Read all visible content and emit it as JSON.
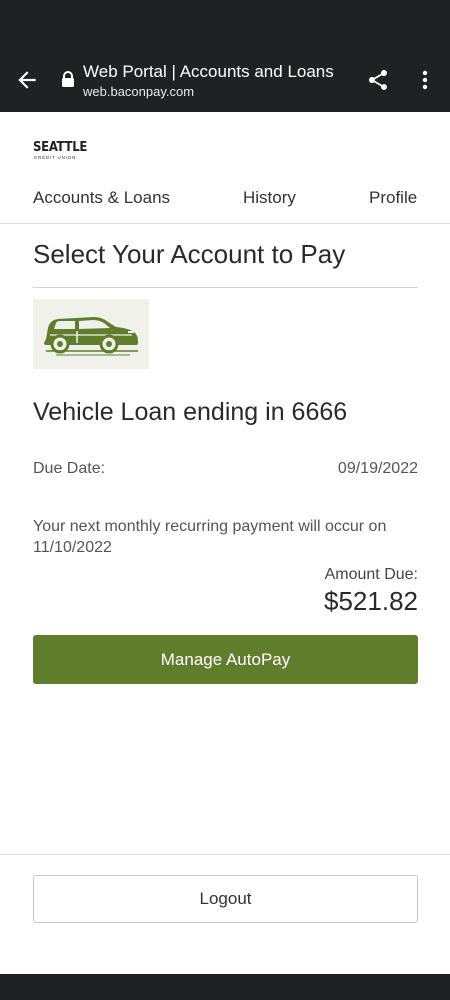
{
  "browser": {
    "page_title": "Web Portal | Accounts and Loans",
    "domain": "web.baconpay.com"
  },
  "site": {
    "logo_main": "SEATTLE",
    "logo_sub": "CREDIT UNION",
    "nav": {
      "accounts": "Accounts & Loans",
      "history": "History",
      "profile": "Profile"
    }
  },
  "main": {
    "page_title": "Select Your Account to Pay",
    "loan_title": "Vehicle Loan ending in 6666",
    "due_date_label": "Due Date:",
    "due_date_value": "09/19/2022",
    "recurring_text": "Your next monthly recurring payment will occur on 11/10/2022",
    "amount_due_label": "Amount Due:",
    "amount_due_value": "$521.82",
    "autopay_button": "Manage AutoPay"
  },
  "footer": {
    "logout_button": "Logout"
  },
  "colors": {
    "brand_green": "#5f7d2b",
    "chrome_dark": "#202124"
  },
  "icons": {
    "back": "back-arrow-icon",
    "lock": "lock-icon",
    "share": "share-icon",
    "more": "more-vert-icon",
    "vehicle": "car-icon"
  }
}
